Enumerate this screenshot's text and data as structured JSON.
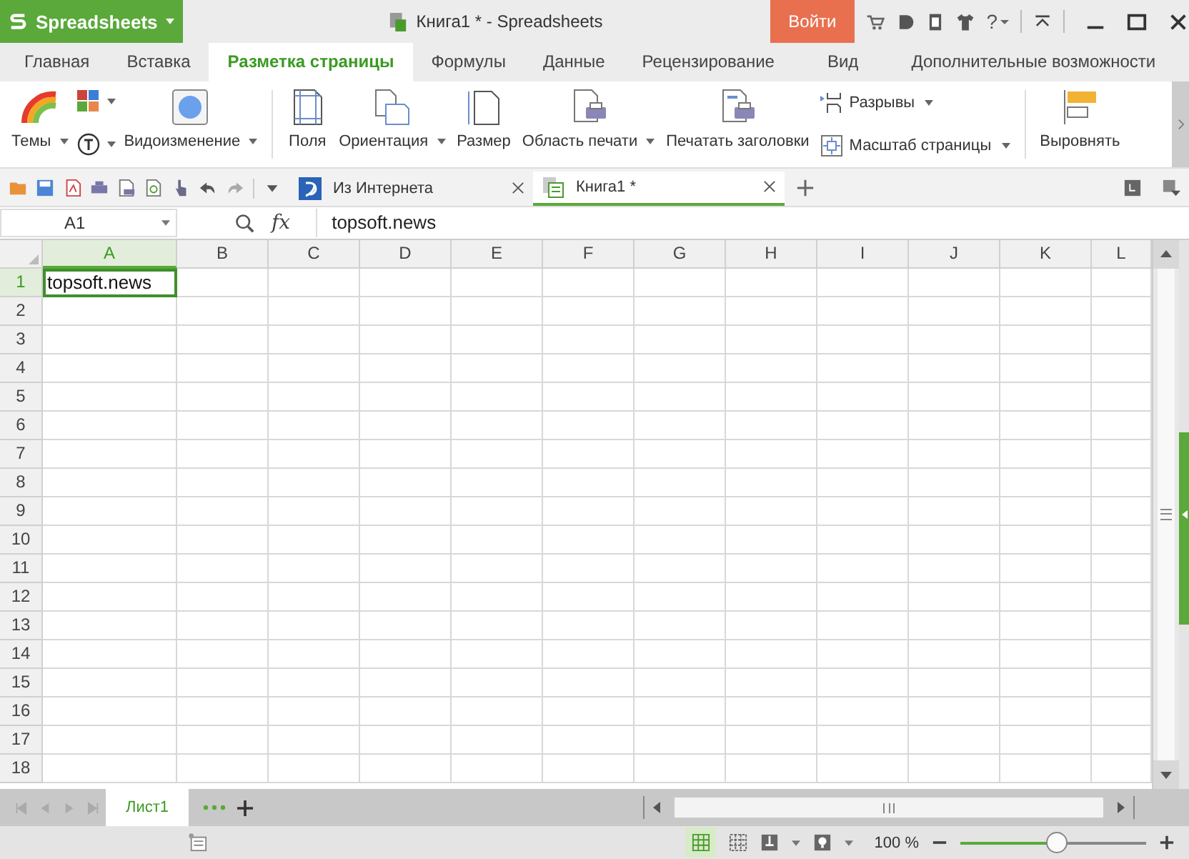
{
  "title_bar": {
    "app_name": "Spreadsheets",
    "document_title": "Книга1 * - Spreadsheets",
    "login_button": "Войти",
    "help": "?"
  },
  "tabs": [
    {
      "label": "Главная",
      "selected": false
    },
    {
      "label": "Вставка",
      "selected": false
    },
    {
      "label": "Разметка страницы",
      "selected": true
    },
    {
      "label": "Формулы",
      "selected": false
    },
    {
      "label": "Данные",
      "selected": false
    },
    {
      "label": "Рецензирование",
      "selected": false
    },
    {
      "label": "Вид",
      "selected": false
    },
    {
      "label": "Дополнительные возможности",
      "selected": false
    }
  ],
  "ribbon": {
    "items": [
      {
        "label": "Темы",
        "dropdown": true
      },
      {
        "label": "Видоизменение",
        "dropdown": true
      },
      {
        "label": "Поля",
        "dropdown": false
      },
      {
        "label": "Ориентация",
        "dropdown": true
      },
      {
        "label": "Размер",
        "dropdown": false
      },
      {
        "label": "Область печати",
        "dropdown": true
      },
      {
        "label": "Печатать заголовки",
        "dropdown": false
      },
      {
        "label": "Разрывы",
        "dropdown": true
      },
      {
        "label": "Масштаб страницы",
        "dropdown": true
      },
      {
        "label": "Выровнять",
        "dropdown": false
      }
    ]
  },
  "document_tabs": [
    {
      "label": "Из Интернета",
      "selected": false
    },
    {
      "label": "Книга1 *",
      "selected": true
    }
  ],
  "formula_bar": {
    "name_box": "A1",
    "fx": "fx",
    "value": "topsoft.news"
  },
  "sheet": {
    "columns": [
      {
        "label": "A",
        "selected": true
      },
      {
        "label": "B",
        "selected": false
      },
      {
        "label": "C",
        "selected": false
      },
      {
        "label": "D",
        "selected": false
      },
      {
        "label": "E",
        "selected": false
      },
      {
        "label": "F",
        "selected": false
      },
      {
        "label": "G",
        "selected": false
      },
      {
        "label": "H",
        "selected": false
      },
      {
        "label": "I",
        "selected": false
      },
      {
        "label": "J",
        "selected": false
      },
      {
        "label": "K",
        "selected": false
      },
      {
        "label": "L",
        "selected": false
      }
    ],
    "rows": [
      {
        "label": "1",
        "selected": true,
        "cells": [
          "topsoft.news"
        ]
      },
      {
        "label": "2",
        "selected": false,
        "cells": []
      },
      {
        "label": "3",
        "selected": false,
        "cells": []
      },
      {
        "label": "4",
        "selected": false,
        "cells": []
      },
      {
        "label": "5",
        "selected": false,
        "cells": []
      },
      {
        "label": "6",
        "selected": false,
        "cells": []
      },
      {
        "label": "7",
        "selected": false,
        "cells": []
      },
      {
        "label": "8",
        "selected": false,
        "cells": []
      },
      {
        "label": "9",
        "selected": false,
        "cells": []
      },
      {
        "label": "10",
        "selected": false,
        "cells": []
      },
      {
        "label": "11",
        "selected": false,
        "cells": []
      },
      {
        "label": "12",
        "selected": false,
        "cells": []
      },
      {
        "label": "13",
        "selected": false,
        "cells": []
      },
      {
        "label": "14",
        "selected": false,
        "cells": []
      },
      {
        "label": "15",
        "selected": false,
        "cells": []
      },
      {
        "label": "16",
        "selected": false,
        "cells": []
      },
      {
        "label": "17",
        "selected": false,
        "cells": []
      },
      {
        "label": "18",
        "selected": false,
        "cells": []
      }
    ]
  },
  "sheet_tabs": [
    {
      "label": "Лист1",
      "selected": true
    }
  ],
  "status_bar": {
    "zoom": "100 %",
    "zoom_slider": {
      "level": 0.52
    }
  }
}
